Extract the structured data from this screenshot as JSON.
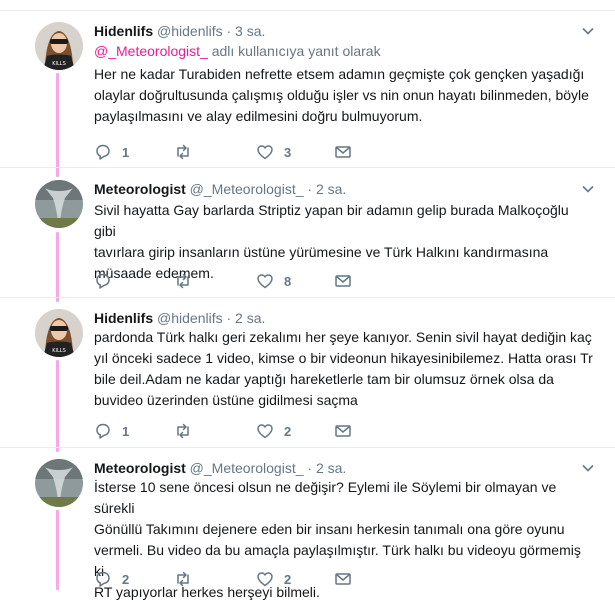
{
  "colors": {
    "accent": "#e81c97",
    "thread_line": "#f6a8e8",
    "muted": "#657786",
    "divider": "#e6ecf0"
  },
  "tweets": [
    {
      "name": "Hidenlifs",
      "handle": "@hidenlifs",
      "dot": "·",
      "time": "3 sa.",
      "reply_mention": "@_Meteorologist_",
      "reply_suffix": " adlı kullanıcıya yanıt olarak",
      "lines": [
        "Her ne kadar Turabiden nefrette etsem adamın geçmişte çok gençken  yaşadığı",
        "olaylar doğrultusunda çalışmış olduğu işler vs nin onun hayatı bilinmeden, böyle",
        "paylaşılmasını ve alay edilmesini doğru bulmuyorum."
      ],
      "avatar_icon": "avatar-photo-woman",
      "replies": "1",
      "retweets": "",
      "likes": "3"
    },
    {
      "name": "Meteorologist",
      "handle": "@_Meteorologist_",
      "dot": "·",
      "time": "2 sa.",
      "lines": [
        "Sivil hayatta Gay barlarda Striptiz yapan bir adamın gelip burada Malkoçoğlu gibi",
        "tavırlara girip insanların üstüne yürümesine ve Türk Halkını kandırmasına",
        "müsaade edemem."
      ],
      "avatar_icon": "avatar-photo-tornado",
      "replies": "",
      "retweets": "",
      "likes": "8"
    },
    {
      "name": "Hidenlifs",
      "handle": "@hidenlifs",
      "dot": "·",
      "time": "2 sa.",
      "lines": [
        "pardonda Türk halkı geri zekalımı her şeye kanıyor. Senin sivil hayat dediğin kaç",
        "yıl önceki sadece 1 video, kimse o bir videonun hikayesinibilemez. Hatta orası Tr",
        "bile deil.Adam ne kadar yaptığı hareketlerle tam bir olumsuz örnek olsa da",
        "buvideo üzerinden üstüne gidilmesi saçma"
      ],
      "avatar_icon": "avatar-photo-woman",
      "replies": "1",
      "retweets": "",
      "likes": "2"
    },
    {
      "name": "Meteorologist",
      "handle": "@_Meteorologist_",
      "dot": "·",
      "time": "2 sa.",
      "lines": [
        "İsterse 10 sene öncesi olsun ne değişir? Eylemi ile Söylemi bir olmayan ve sürekli",
        "Gönüllü Takımını dejenere eden bir insanı herkesin tanımalı ona göre oyunu",
        "vermeli. Bu video da bu amaçla paylaşılmıştır. Türk halkı bu videoyu görmemiş ki",
        "RT yapıyorlar herkes herşeyi bilmeli."
      ],
      "avatar_icon": "avatar-photo-tornado",
      "replies": "2",
      "retweets": "",
      "likes": "2"
    }
  ]
}
